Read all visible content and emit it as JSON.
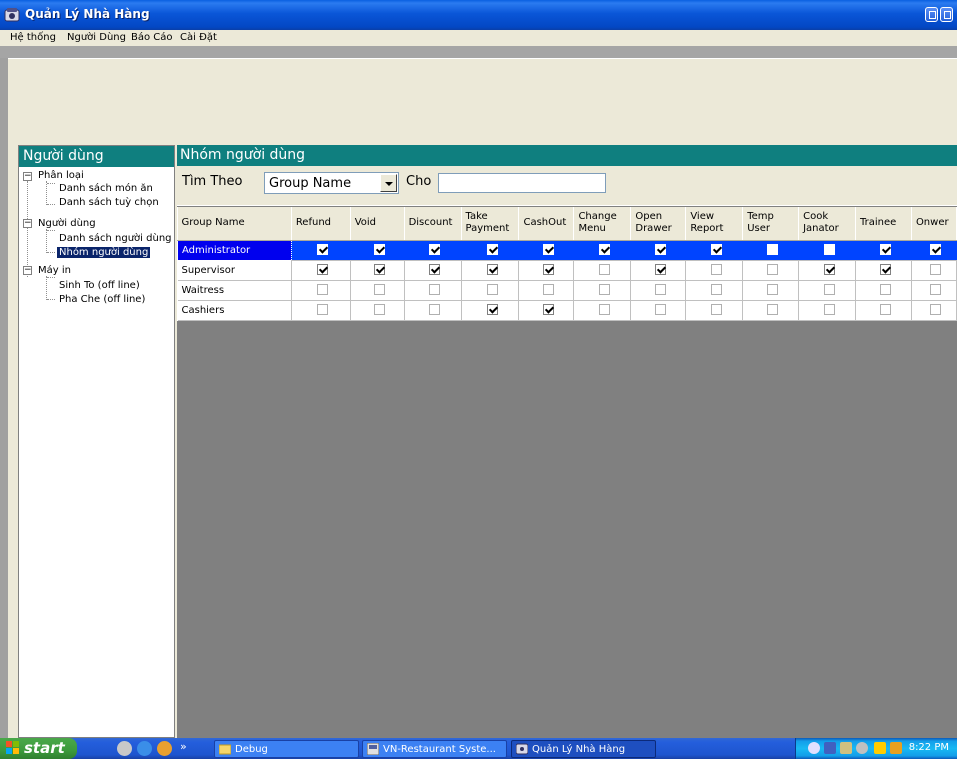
{
  "window": {
    "title": "Quản Lý Nhà Hàng"
  },
  "menu": [
    "Hệ thống",
    "Người Dùng",
    "Báo Cáo",
    "Cài Đặt"
  ],
  "left_pane": {
    "header": "Người dùng",
    "tree": [
      {
        "label": "Phân loại",
        "children": [
          "Danh sách món ăn",
          "Danh sách tuỳ chọn"
        ]
      },
      {
        "label": "Người dùng",
        "children": [
          "Danh sách người dùng",
          "Nhóm người dùng"
        ]
      },
      {
        "label": "Máy in",
        "children": [
          "Sinh To (off line)",
          "Pha Che (off line)"
        ]
      }
    ],
    "selected": "Nhóm người dùng"
  },
  "right_pane": {
    "header": "Nhóm người dùng",
    "search": {
      "label": "Tìm Theo",
      "field_value": "Group Name",
      "cho_label": "Cho",
      "cho_value": ""
    }
  },
  "grid": {
    "columns": [
      "Group Name",
      "Refund",
      "Void",
      "Discount",
      "Take Payment",
      "CashOut",
      "Change Menu",
      "Open Drawer",
      "View Report",
      "Temp User",
      "Cook Janator",
      "Trainee",
      "Onwer"
    ],
    "rows": [
      {
        "name": "Administrator",
        "selected": true,
        "flags": [
          true,
          true,
          true,
          true,
          true,
          true,
          true,
          true,
          false,
          false,
          true,
          true
        ]
      },
      {
        "name": "Supervisor",
        "selected": false,
        "flags": [
          true,
          true,
          true,
          true,
          true,
          false,
          true,
          false,
          false,
          true,
          true,
          false
        ]
      },
      {
        "name": "Waitress",
        "selected": false,
        "flags": [
          false,
          false,
          false,
          false,
          false,
          false,
          false,
          false,
          false,
          false,
          false,
          false
        ]
      },
      {
        "name": "Cashiers",
        "selected": false,
        "flags": [
          false,
          false,
          false,
          true,
          true,
          false,
          false,
          false,
          false,
          false,
          false,
          false
        ]
      }
    ]
  },
  "taskbar": {
    "start_label": "start",
    "quick_launch_more": "»",
    "tasks": [
      "Debug",
      "VN-Restaurant Syste...",
      "Quản Lý Nhà Hàng"
    ],
    "active_task": "Quản Lý Nhà Hàng",
    "clock": "8:22 PM"
  },
  "colors": {
    "title_blue": "#0a56d8",
    "pane_header_teal": "#0f7f7f",
    "selection_blue": "#0044ff",
    "taskbar_blue": "#245edc",
    "start_green": "#3c9a3c"
  }
}
